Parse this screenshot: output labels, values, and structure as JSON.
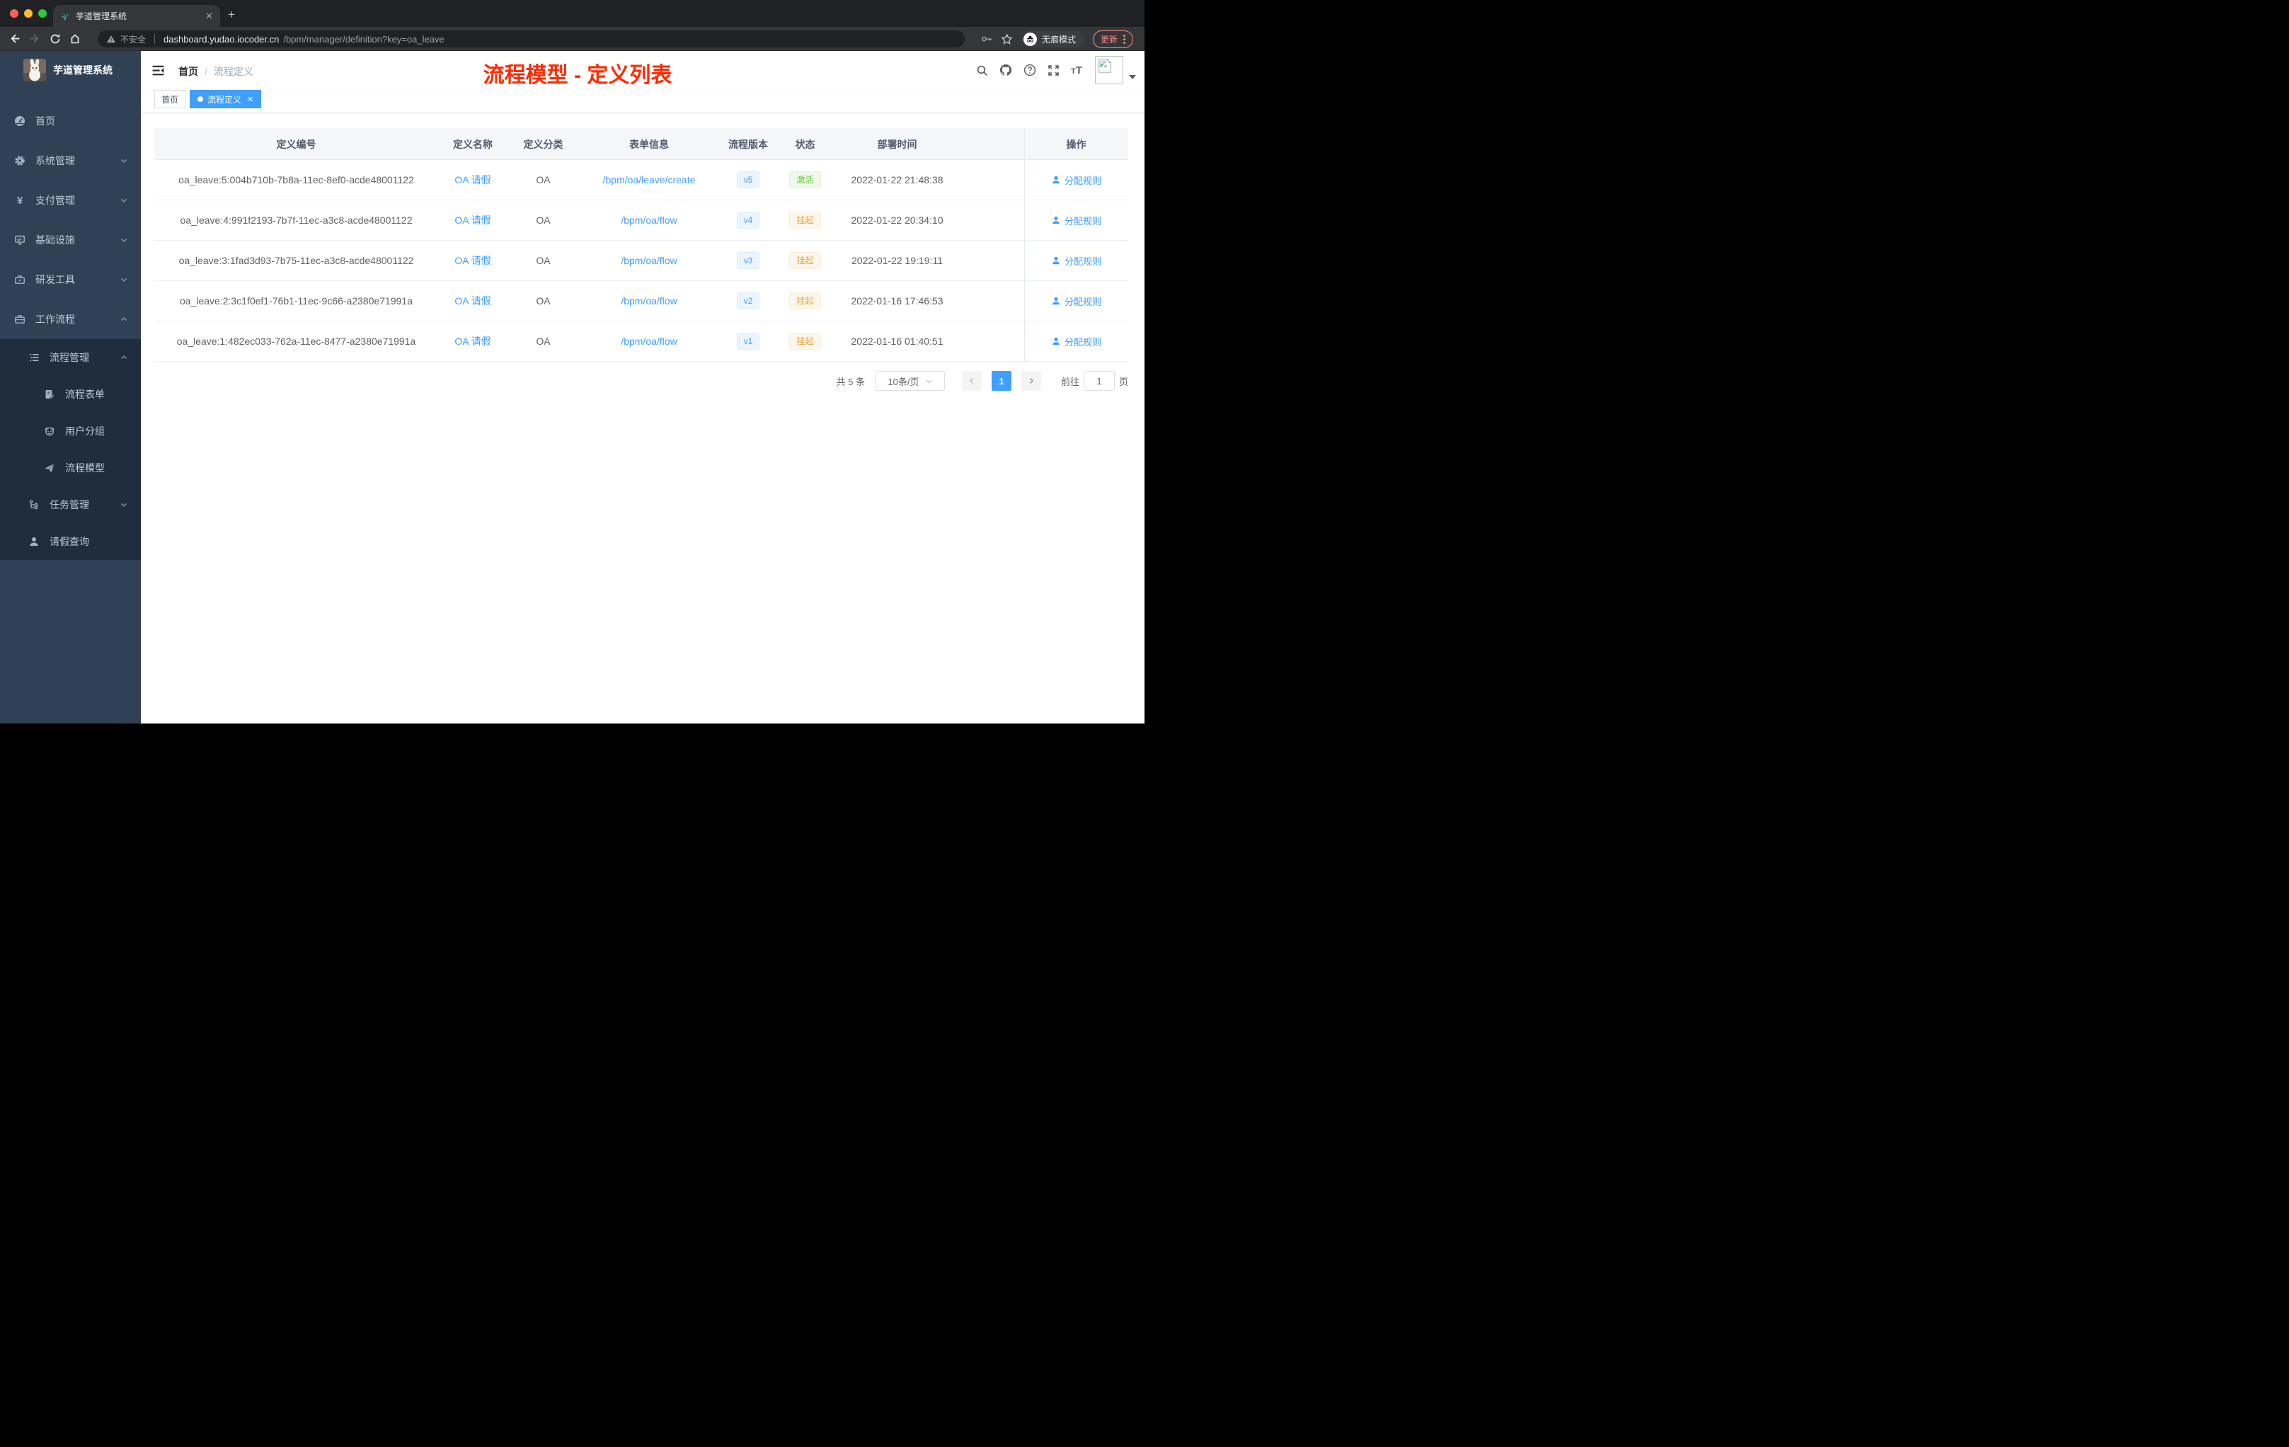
{
  "browser": {
    "tab": {
      "title": "芋道管理系统"
    },
    "toolbar": {
      "security_label": "不安全",
      "url_host": "dashboard.yudao.iocoder.cn",
      "url_path": "/bpm/manager/definition?key=oa_leave",
      "incognito_label": "无痕模式",
      "update_label": "更新"
    }
  },
  "sidebar": {
    "logo_title": "芋道管理系统",
    "menu": [
      {
        "label": "首页"
      },
      {
        "label": "系统管理"
      },
      {
        "label": "支付管理"
      },
      {
        "label": "基础设施"
      },
      {
        "label": "研发工具"
      },
      {
        "label": "工作流程"
      },
      {
        "label": "流程管理"
      },
      {
        "label": "流程表单"
      },
      {
        "label": "用户分组"
      },
      {
        "label": "流程模型"
      },
      {
        "label": "任务管理"
      },
      {
        "label": "请假查询"
      }
    ]
  },
  "navbar": {
    "breadcrumb": {
      "home": "首页",
      "sep": "/",
      "current": "流程定义"
    },
    "annotation": "流程模型 - 定义列表"
  },
  "tags": {
    "home": "首页",
    "active": "流程定义"
  },
  "table": {
    "columns": {
      "id": "定义编号",
      "name": "定义名称",
      "category": "定义分类",
      "form": "表单信息",
      "version": "流程版本",
      "status": "状态",
      "deployed": "部署时间",
      "action": "操作"
    },
    "rows": [
      {
        "id": "oa_leave:5:004b710b-7b8a-11ec-8ef0-acde48001122",
        "name": "OA 请假",
        "category": "OA",
        "form": "/bpm/oa/leave/create",
        "version": "v5",
        "status": "激活",
        "status_type": "success",
        "deployed": "2022-01-22 21:48:38",
        "action": "分配规则"
      },
      {
        "id": "oa_leave:4:991f2193-7b7f-11ec-a3c8-acde48001122",
        "name": "OA 请假",
        "category": "OA",
        "form": "/bpm/oa/flow",
        "version": "v4",
        "status": "挂起",
        "status_type": "warning",
        "deployed": "2022-01-22 20:34:10",
        "action": "分配规则"
      },
      {
        "id": "oa_leave:3:1fad3d93-7b75-11ec-a3c8-acde48001122",
        "name": "OA 请假",
        "category": "OA",
        "form": "/bpm/oa/flow",
        "version": "v3",
        "status": "挂起",
        "status_type": "warning",
        "deployed": "2022-01-22 19:19:11",
        "action": "分配规则"
      },
      {
        "id": "oa_leave:2:3c1f0ef1-76b1-11ec-9c66-a2380e71991a",
        "name": "OA 请假",
        "category": "OA",
        "form": "/bpm/oa/flow",
        "version": "v2",
        "status": "挂起",
        "status_type": "warning",
        "deployed": "2022-01-16 17:46:53",
        "action": "分配规则"
      },
      {
        "id": "oa_leave:1:482ec033-762a-11ec-8477-a2380e71991a",
        "name": "OA 请假",
        "category": "OA",
        "form": "/bpm/oa/flow",
        "version": "v1",
        "status": "挂起",
        "status_type": "warning",
        "deployed": "2022-01-16 01:40:51",
        "action": "分配规则"
      }
    ]
  },
  "pagination": {
    "total": "共 5 条",
    "page_size": "10条/页",
    "current_page": "1",
    "goto_label": "前往",
    "goto_value": "1",
    "page_unit": "页"
  },
  "colors": {
    "accent": "#409eff",
    "annotation_red": "#ff2b00",
    "status_active": "#67c23a",
    "status_suspended": "#e6a23c",
    "sidebar_bg": "#304156",
    "submenu_bg": "#1f2d3d"
  }
}
